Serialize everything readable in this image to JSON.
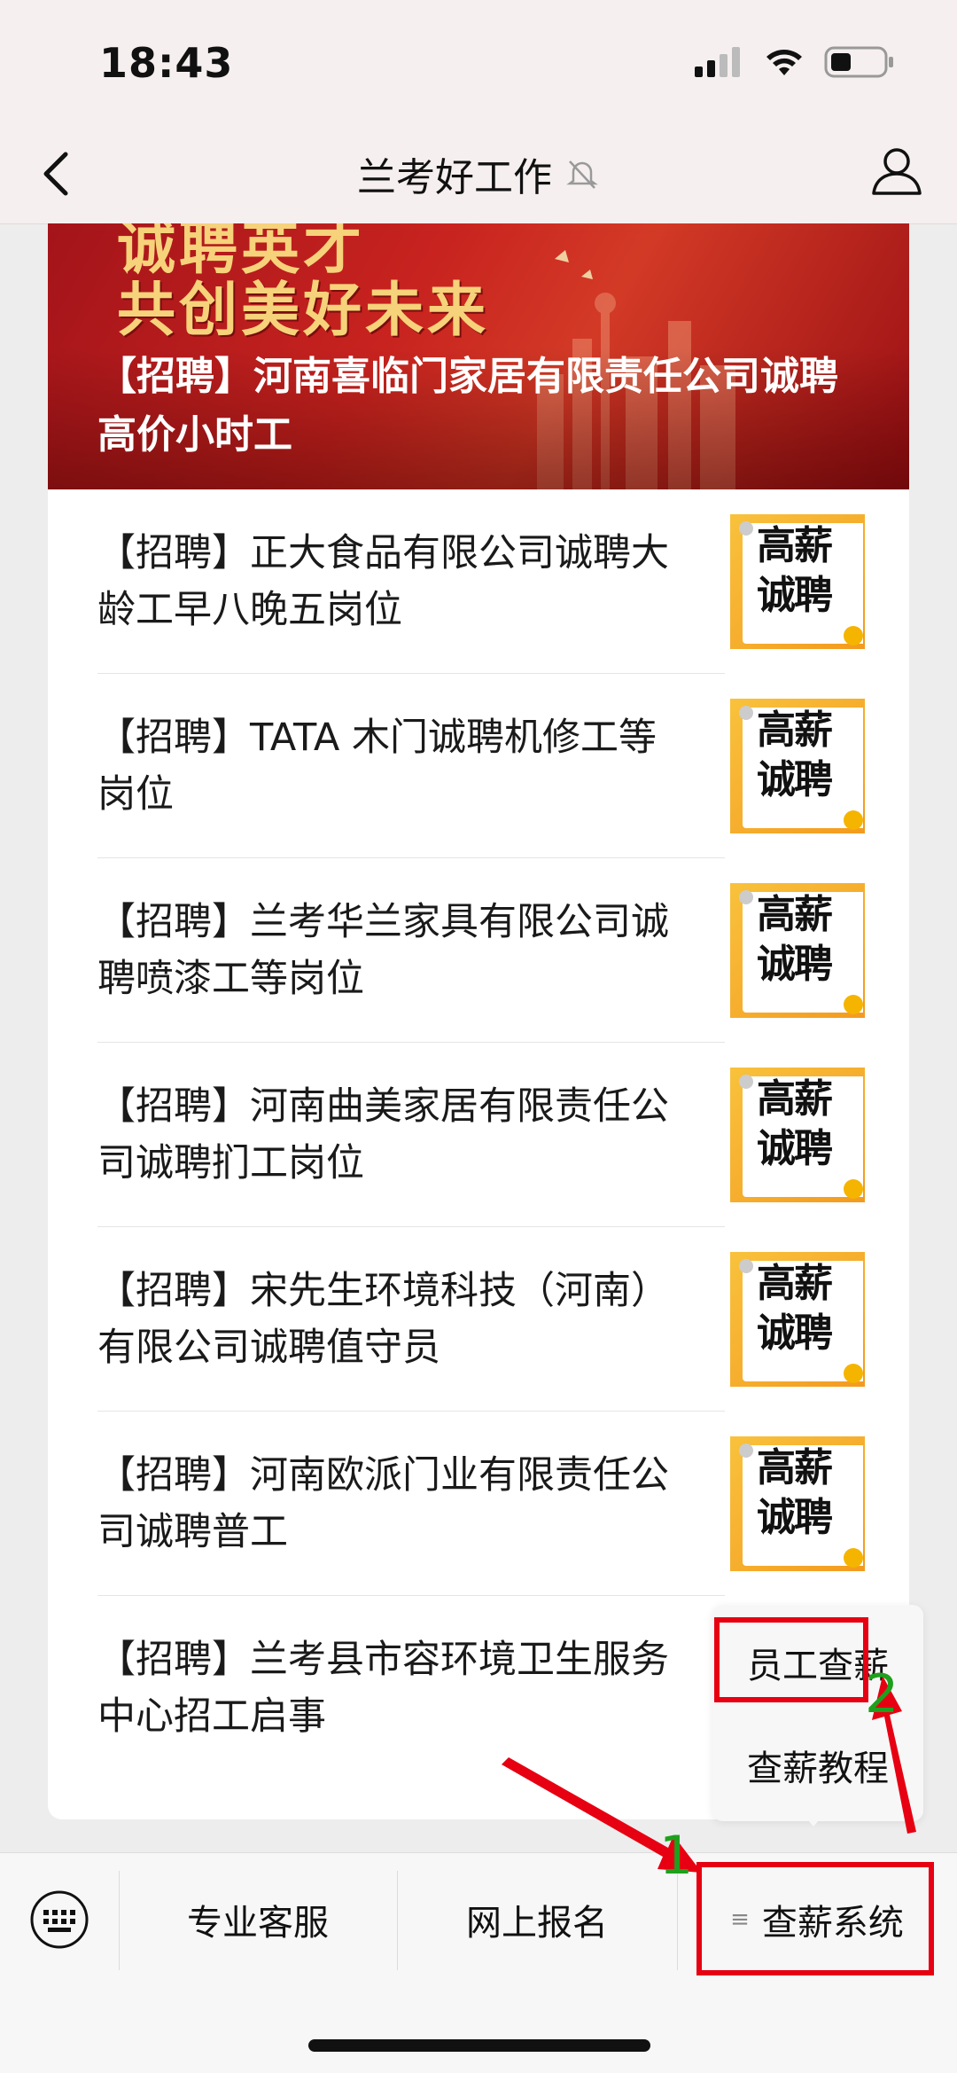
{
  "status": {
    "time": "18:43"
  },
  "nav": {
    "title": "兰考好工作"
  },
  "banner": {
    "slogan_top": "诚聘英才",
    "slogan": "共创美好未来",
    "title": "【招聘】河南喜临门家居有限责任公司诚聘高价小时工"
  },
  "articles": [
    {
      "title": "【招聘】正大食品有限公司诚聘大龄工早八晚五岗位",
      "thumb": "高薪诚聘"
    },
    {
      "title": "【招聘】TATA 木门诚聘机修工等岗位",
      "thumb": "高薪诚聘"
    },
    {
      "title": "【招聘】兰考华兰家具有限公司诚聘喷漆工等岗位",
      "thumb": "高薪诚聘"
    },
    {
      "title": "【招聘】河南曲美家居有限责任公司诚聘扪工岗位",
      "thumb": "高薪诚聘"
    },
    {
      "title": "【招聘】宋先生环境科技（河南）有限公司诚聘值守员",
      "thumb": "高薪诚聘"
    },
    {
      "title": "【招聘】河南欧派门业有限责任公司诚聘普工",
      "thumb": "高薪诚聘"
    },
    {
      "title": "【招聘】兰考县市容环境卫生服务中心招工启事"
    }
  ],
  "menu": {
    "tabs": [
      "专业客服",
      "网上报名",
      "查薪系统"
    ],
    "tab_prefix": "≡",
    "popup": [
      "员工查薪",
      "查薪教程"
    ]
  },
  "annotations": {
    "step1": "1",
    "step2": "2",
    "color": "#e60012"
  },
  "icons": [
    "back-arrow-icon",
    "mute-bell-icon",
    "user-icon",
    "keyboard-icon",
    "signal-icon",
    "wifi-icon",
    "battery-icon"
  ]
}
